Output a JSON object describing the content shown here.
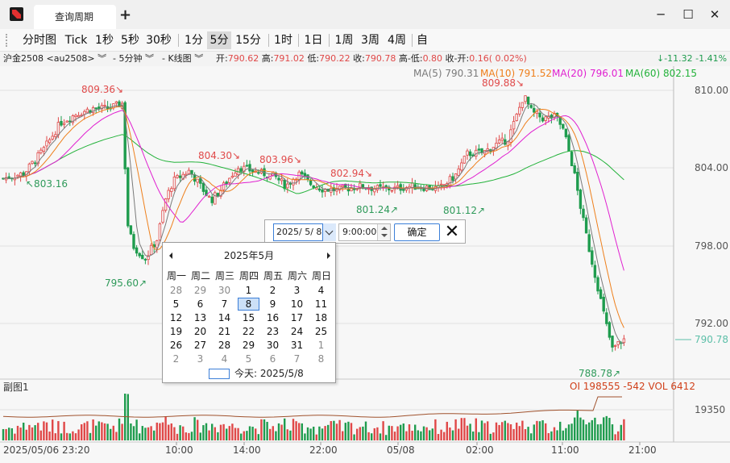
{
  "titlebar": {
    "tab_label": "查询周期",
    "add_tab": "+",
    "minimize": "─",
    "maximize": "☐",
    "close": "✕"
  },
  "toolbar": {
    "items": [
      "分时图",
      "Tick",
      "1秒",
      "5秒",
      "30秒",
      "1分",
      "5分",
      "15分",
      "1时",
      "1日",
      "1周",
      "3周",
      "4周",
      "自"
    ],
    "selected": "5分"
  },
  "info": {
    "contract": "沪金2508 <au2508>",
    "period": "- 5分钟",
    "chart_type": "- K线图",
    "open_label": "开:",
    "open": "790.62",
    "high_label": "高:",
    "high": "791.02",
    "low_label": "低:",
    "low": "790.22",
    "close_label": "收:",
    "close": "790.78",
    "high_low_label": "高-低:",
    "high_low": "0.80",
    "close_open_label": "收-开:",
    "close_open": "0.16( 0.02%)",
    "change": "↓-11.32 -1.41%"
  },
  "ma_legend": [
    {
      "text": "MA(5) 790.31",
      "color": "#7a7a7a"
    },
    {
      "text": "MA(10) 791.52",
      "color": "#ee7f1b"
    },
    {
      "text": "MA(20) 796.01",
      "color": "#e020d0"
    },
    {
      "text": "MA(60) 802.15",
      "color": "#23b23a"
    }
  ],
  "chart": {
    "price_labels": [
      "810.00",
      "804.00",
      "798.00",
      "792.00"
    ],
    "current_price": "790.78",
    "annotations": [
      {
        "text": "809.36↘",
        "color": "#e04a4a"
      },
      {
        "text": "804.30↘",
        "color": "#e04a4a"
      },
      {
        "text": "803.96↘",
        "color": "#e04a4a"
      },
      {
        "text": "802.94↘",
        "color": "#e04a4a"
      },
      {
        "text": "809.88↘",
        "color": "#e04a4a"
      },
      {
        "text": "↖803.16",
        "color": "#2f9a5a"
      },
      {
        "text": "795.60↗",
        "color": "#2f9a5a"
      },
      {
        "text": "801.24↗",
        "color": "#2f9a5a"
      },
      {
        "text": "801.12↗",
        "color": "#2f9a5a"
      },
      {
        "text": "788.78↗",
        "color": "#2f9a5a"
      }
    ],
    "sub_title": "副图1",
    "sub_stats": "OI 198555  -542   VOL 6412",
    "sub_price_label": "19350",
    "time_labels": [
      "2025/05/06 23:20",
      "10:00",
      "14:00",
      "22:00",
      "05/08",
      "02:00",
      "11:00",
      "21:00"
    ]
  },
  "picker": {
    "date_value": "2025/ 5/  8",
    "time_value": "9:00:00",
    "confirm_label": "确定",
    "close_label": "✕"
  },
  "calendar": {
    "month_title": "2025年5月",
    "weekdays": [
      "周一",
      "周二",
      "周三",
      "周四",
      "周五",
      "周六",
      "周日"
    ],
    "days": [
      [
        "28",
        "29",
        "30",
        "1",
        "2",
        "3",
        "4"
      ],
      [
        "5",
        "6",
        "7",
        "8",
        "9",
        "10",
        "11"
      ],
      [
        "12",
        "13",
        "14",
        "15",
        "16",
        "17",
        "18"
      ],
      [
        "19",
        "20",
        "21",
        "22",
        "23",
        "24",
        "25"
      ],
      [
        "26",
        "27",
        "28",
        "29",
        "30",
        "31",
        "1"
      ],
      [
        "2",
        "3",
        "4",
        "5",
        "6",
        "7",
        "8"
      ]
    ],
    "today_text": "今天: 2025/5/8"
  },
  "colors": {
    "up": "#e04848",
    "down": "#1f9c4e",
    "ma5": "#7a7a7a",
    "ma10": "#ee7f1b",
    "ma20": "#e020d0",
    "ma60": "#23b23a",
    "oi": "#a0522d",
    "accent": "#3c7fd8"
  }
}
